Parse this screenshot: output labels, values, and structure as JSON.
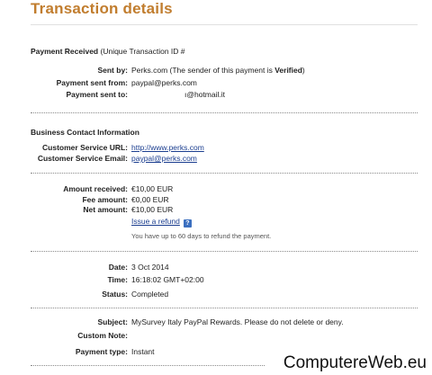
{
  "title": "Transaction details",
  "payment_received": {
    "heading": "Payment Received",
    "heading_suffix": "(Unique Transaction ID #",
    "sent_by_label": "Sent by:",
    "sent_by_value_prefix": "Perks.com (The sender of this payment is ",
    "sent_by_value_status": "Verified",
    "sent_by_value_suffix": ")",
    "sent_from_label": "Payment sent from:",
    "sent_from_value": "paypal@perks.com",
    "sent_to_label": "Payment sent to:",
    "sent_to_value": "ı@hotmail.it"
  },
  "business": {
    "heading": "Business Contact Information",
    "url_label": "Customer Service URL:",
    "url_value": "http://www.perks.com",
    "email_label": "Customer Service Email:",
    "email_value": "paypal@perks.com"
  },
  "amounts": {
    "received_label": "Amount received:",
    "received_value": "€10,00 EUR",
    "fee_label": "Fee amount:",
    "fee_value": "€0,00 EUR",
    "net_label": "Net amount:",
    "net_value": "€10,00 EUR",
    "refund_link": "Issue a refund",
    "help_icon": "?",
    "refund_note": "You have up to 60 days to refund the payment."
  },
  "details": {
    "date_label": "Date:",
    "date_value": "3 Oct 2014",
    "time_label": "Time:",
    "time_value": "16:18:02 GMT+02:00",
    "status_label": "Status:",
    "status_value": "Completed"
  },
  "misc": {
    "subject_label": "Subject:",
    "subject_value": "MySurvey Italy PayPal Rewards. Please do not delete or deny.",
    "note_label": "Custom Note:",
    "note_value": "",
    "type_label": "Payment type:",
    "type_value": "Instant"
  },
  "watermark": "ComputereWeb.eu",
  "colors": {
    "title": "#c17d2e",
    "link": "#1a3d8f",
    "help_icon": "#3b6fbf"
  }
}
